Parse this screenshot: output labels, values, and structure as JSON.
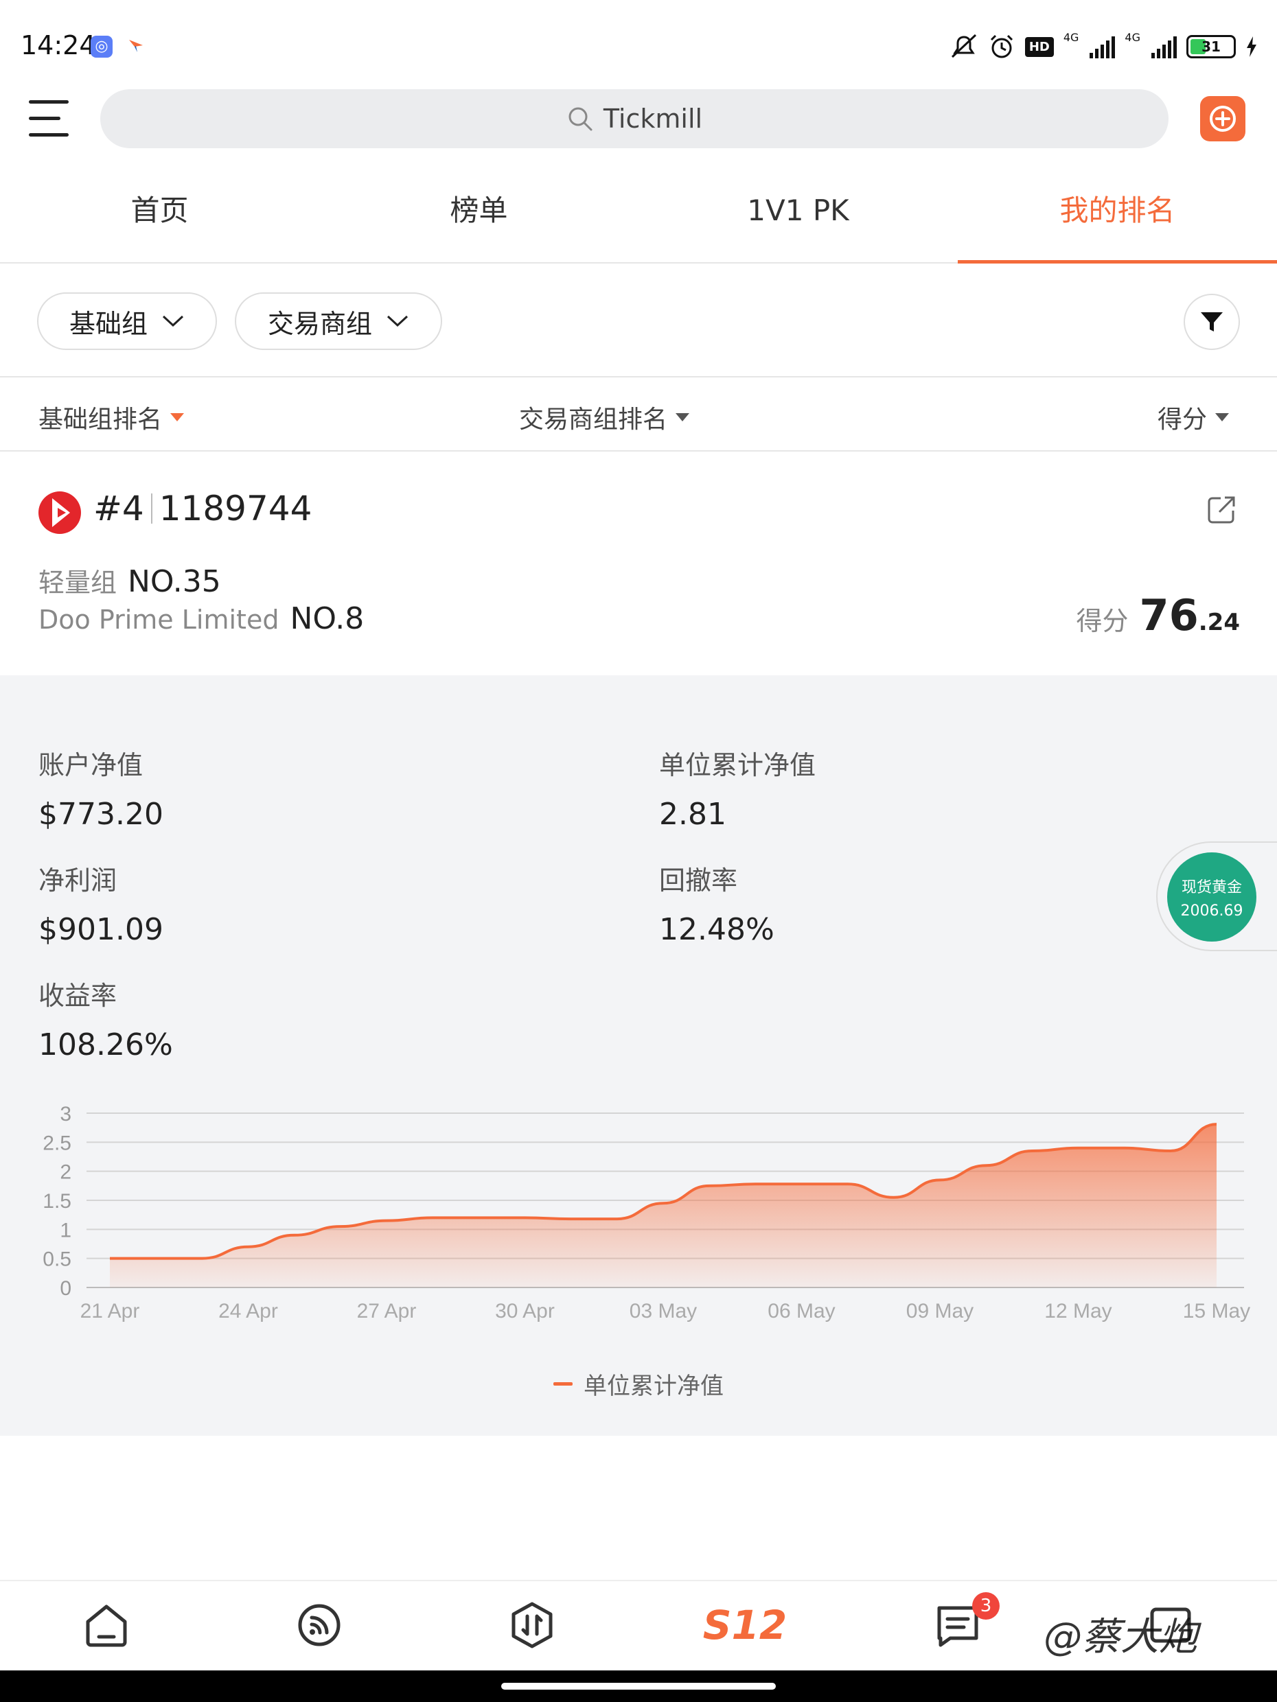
{
  "status_bar": {
    "time": "14:24",
    "network_label_1": "4G",
    "network_label_2": "4G",
    "hd_label": "HD",
    "battery": "31"
  },
  "search": {
    "value": "Tickmill"
  },
  "tabs": [
    {
      "label": "首页"
    },
    {
      "label": "榜单"
    },
    {
      "label": "1V1 PK"
    },
    {
      "label": "我的排名"
    }
  ],
  "filters": {
    "group": "基础组",
    "broker_group": "交易商组"
  },
  "sort": {
    "col1": "基础组排名",
    "col2": "交易商组排名",
    "col3": "得分"
  },
  "account": {
    "rank": "#4",
    "account_id": "1189744",
    "group_name": "轻量组",
    "group_rank": "NO.35",
    "broker_name": "Doo Prime Limited",
    "broker_rank": "NO.8",
    "score_label": "得分",
    "score_int": "76",
    "score_dec": ".24"
  },
  "stats": {
    "equity_label": "账户净值",
    "equity": "$773.20",
    "nav_label": "单位累计净值",
    "nav": "2.81",
    "profit_label": "净利润",
    "profit": "$901.09",
    "drawdown_label": "回撤率",
    "drawdown": "12.48%",
    "return_label": "收益率",
    "return": "108.26%"
  },
  "gold_widget": {
    "label": "现货黄金",
    "price": "2006.69"
  },
  "chart_data": {
    "type": "area",
    "x": [
      "21 Apr",
      "22 Apr",
      "23 Apr",
      "24 Apr",
      "25 Apr",
      "26 Apr",
      "27 Apr",
      "28 Apr",
      "29 Apr",
      "30 Apr",
      "01 May",
      "02 May",
      "03 May",
      "04 May",
      "05 May",
      "06 May",
      "07 May",
      "08 May",
      "09 May",
      "10 May",
      "11 May",
      "12 May",
      "13 May",
      "14 May",
      "15 May"
    ],
    "x_tick_labels": [
      "21 Apr",
      "24 Apr",
      "27 Apr",
      "30 Apr",
      "03 May",
      "06 May",
      "09 May",
      "12 May",
      "15 May"
    ],
    "series": [
      {
        "name": "单位累计净值",
        "values": [
          0.5,
          0.5,
          0.5,
          0.7,
          0.9,
          1.05,
          1.15,
          1.2,
          1.2,
          1.2,
          1.18,
          1.18,
          1.45,
          1.75,
          1.78,
          1.78,
          1.78,
          1.55,
          1.85,
          2.1,
          2.35,
          2.4,
          2.4,
          2.35,
          2.81
        ]
      }
    ],
    "y_ticks": [
      "0",
      "0.5",
      "1",
      "1.5",
      "2",
      "2.5",
      "3"
    ],
    "ylim": [
      0,
      3
    ],
    "grid": true,
    "legend": "bottom-center",
    "color": "#f46b3b"
  },
  "bottom_nav": {
    "s12_label": "S12",
    "badge_count": "3",
    "watermark": "@蔡大炮"
  }
}
